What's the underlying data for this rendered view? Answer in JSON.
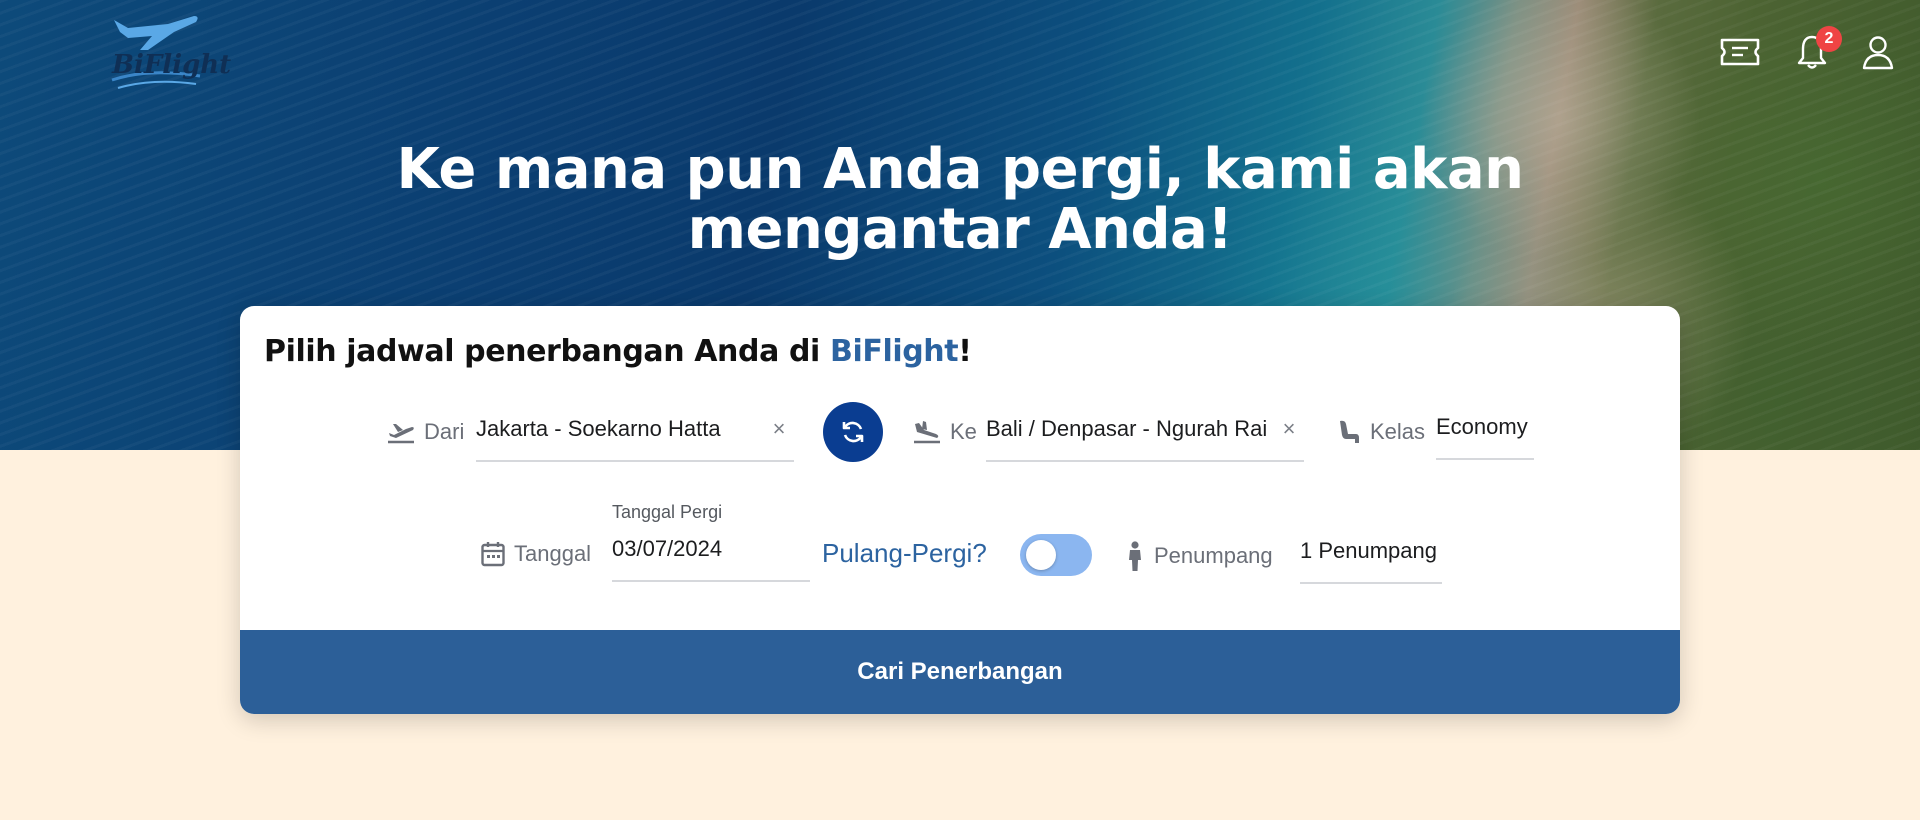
{
  "header": {
    "logo_text": "BiFlight",
    "notifications_count": "2",
    "icons": [
      "ticket-icon",
      "bell-icon",
      "user-icon"
    ]
  },
  "hero": {
    "headline": "Ke mana pun Anda pergi, kami akan mengantar Anda!"
  },
  "search_card": {
    "title_prefix": "Pilih jadwal penerbangan Anda di ",
    "title_brand": "BiFlight",
    "title_suffix": "!",
    "from": {
      "label": "Dari",
      "value": "Jakarta - Soekarno Hatta"
    },
    "to": {
      "label": "Ke",
      "value": "Bali / Denpasar - Ngurah Rai"
    },
    "class": {
      "label": "Kelas",
      "value": "Economy"
    },
    "date": {
      "label": "Tanggal",
      "sublabel": "Tanggal Pergi",
      "value": "03/07/2024"
    },
    "round_trip": {
      "label": "Pulang-Pergi?",
      "enabled": false
    },
    "passengers": {
      "label": "Penumpang",
      "value": "1 Penumpang"
    },
    "clear_glyph": "×",
    "search_button": "Cari Penerbangan"
  },
  "colors": {
    "brand_blue": "#2c63a0",
    "swap_button": "#0a3d91",
    "search_button": "#2c5f98",
    "page_bg": "#fff1de",
    "badge": "#ef4444",
    "toggle_track": "#8bb6f0"
  }
}
